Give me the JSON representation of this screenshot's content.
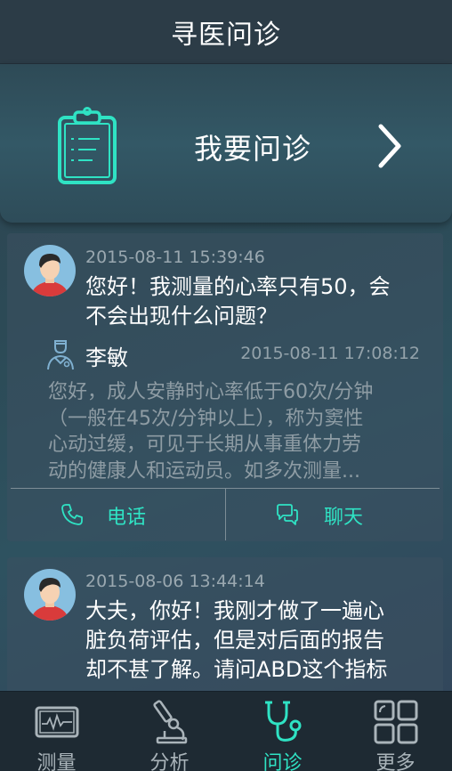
{
  "header": {
    "title": "寻医问诊"
  },
  "banner": {
    "label": "我要问诊",
    "icon": "clipboard-icon",
    "chevron": "chevron-right-icon"
  },
  "consultations": [
    {
      "question_time": "2015-08-11 15:39:46",
      "question_lines": [
        "您好！我测量的心率只有50，会",
        "不会出现什么问题？"
      ],
      "doctor_name": "李敏",
      "answer_time": "2015-08-11 17:08:12",
      "answer_lines": [
        "您好，成人安静时心率低于60次/分钟",
        "（一般在45次/分钟以上），称为窦性",
        "心动过缓，可见于长期从事重体力劳",
        "动的健康人和运动员。如多次测量..."
      ],
      "actions": {
        "phone": "电话",
        "chat": "聊天"
      }
    },
    {
      "question_time": "2015-08-06 13:44:14",
      "question_lines": [
        "大夫，你好！我刚才做了一遍心",
        "脏负荷评估，但是对后面的报告",
        "却不甚了解。请问ABD这个指标"
      ]
    }
  ],
  "tabs": [
    {
      "label": "测量",
      "icon": "heart-monitor-icon",
      "active": false
    },
    {
      "label": "分析",
      "icon": "microscope-icon",
      "active": false
    },
    {
      "label": "问诊",
      "icon": "stethoscope-icon",
      "active": true
    },
    {
      "label": "更多",
      "icon": "grid-icon",
      "active": false
    }
  ],
  "colors": {
    "accent": "#2fe3c4",
    "titlebar": "#2c3c47",
    "tabbar": "#1e2a33"
  }
}
